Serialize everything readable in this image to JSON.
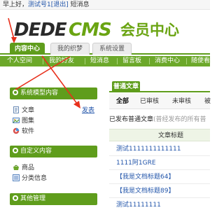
{
  "topbar": {
    "greeting": "早上好，",
    "username": "测试号1",
    "logout": "[退出]",
    "messages": "短消息"
  },
  "logo": {
    "part1": "DEDE",
    "part2": "CMS",
    "subtitle": "会员中心"
  },
  "main_tabs": [
    {
      "label": "内容中心",
      "active": true
    },
    {
      "label": "我的织梦",
      "active": false
    },
    {
      "label": "系统设置",
      "active": false
    }
  ],
  "sub_nav": [
    {
      "label": "个人空间"
    },
    {
      "label": "我的好友"
    },
    {
      "label": "短消息"
    },
    {
      "label": "留言板"
    },
    {
      "label": "消费中心"
    },
    {
      "label": "随便看看"
    }
  ],
  "sidebar": {
    "sections": [
      {
        "title": "系统模型内容",
        "items": [
          {
            "label": "文章",
            "action": "发表",
            "icon": "document-icon"
          },
          {
            "label": "图集",
            "icon": "gallery-icon"
          },
          {
            "label": "软件",
            "icon": "software-icon"
          }
        ]
      },
      {
        "title": "自定义内容",
        "items": [
          {
            "label": "商品",
            "icon": "basket-icon"
          },
          {
            "label": "分类信息",
            "icon": "list-icon"
          }
        ]
      },
      {
        "title": "其他管理",
        "items": []
      }
    ]
  },
  "content": {
    "tab": "普通文章",
    "filters": [
      "全部",
      "已审核",
      "未审核",
      "被"
    ],
    "info_prefix": "已发布普通文章",
    "info_muted": "(普经发布的所有普",
    "table_header": "文章标题",
    "rows": [
      "测试1111111111111",
      "1111阿1GRE",
      "【我是文档标题64】",
      "【我是文档标题89】",
      "测试11111111"
    ]
  },
  "colors": {
    "brand_green": "#5f9d1c",
    "link_blue": "#2255aa",
    "annotation_red": "#e8301c"
  }
}
